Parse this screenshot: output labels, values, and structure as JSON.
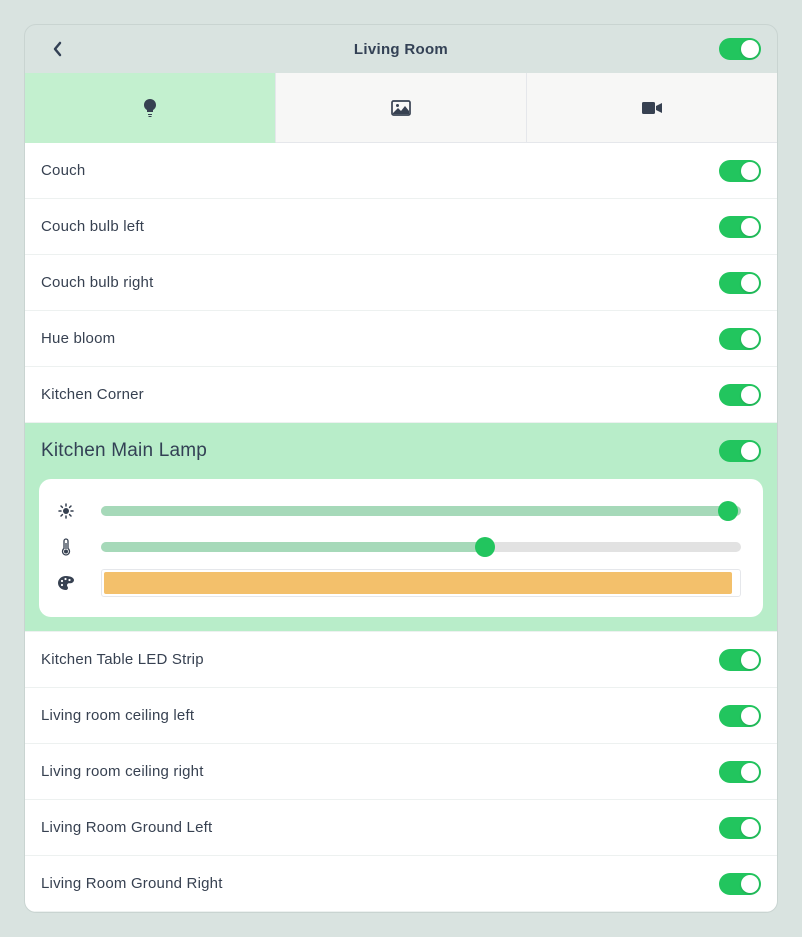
{
  "header": {
    "title": "Living Room",
    "masterOn": true
  },
  "tabs": {
    "activeIndex": 0,
    "items": [
      {
        "icon": "bulb-icon"
      },
      {
        "icon": "picture-icon"
      },
      {
        "icon": "video-icon"
      }
    ]
  },
  "lights": [
    {
      "label": "Couch",
      "on": true,
      "expanded": false
    },
    {
      "label": "Couch bulb left",
      "on": true,
      "expanded": false
    },
    {
      "label": "Couch bulb right",
      "on": true,
      "expanded": false
    },
    {
      "label": "Hue bloom",
      "on": true,
      "expanded": false
    },
    {
      "label": "Kitchen Corner",
      "on": true,
      "expanded": false
    },
    {
      "label": "Kitchen Main Lamp",
      "on": true,
      "expanded": true,
      "brightness": 100,
      "temperature": 60,
      "color": "#f3c06b"
    },
    {
      "label": "Kitchen Table LED Strip",
      "on": true,
      "expanded": false
    },
    {
      "label": "Living room ceiling left",
      "on": true,
      "expanded": false
    },
    {
      "label": "Living room ceiling right",
      "on": true,
      "expanded": false
    },
    {
      "label": "Living Room Ground Left",
      "on": true,
      "expanded": false
    },
    {
      "label": "Living Room Ground Right",
      "on": true,
      "expanded": false
    }
  ],
  "colors": {
    "accent": "#22c55e",
    "expandedBg": "#b8edc9",
    "sliderFill": "#a6d9b9"
  }
}
